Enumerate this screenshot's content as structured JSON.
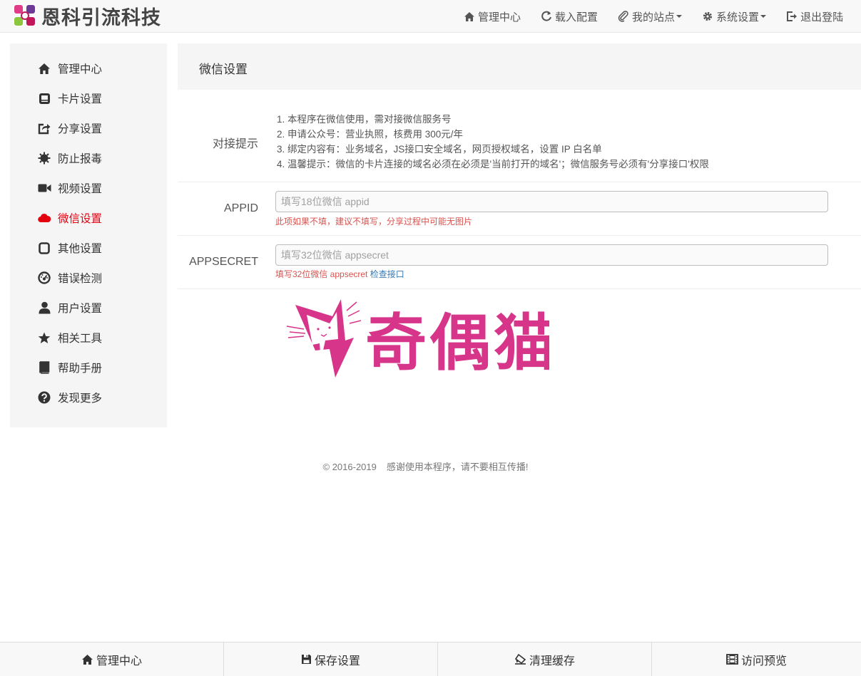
{
  "brand": {
    "name": "恩科引流科技"
  },
  "nav": {
    "items": [
      {
        "label": "管理中心",
        "icon": "home-icon"
      },
      {
        "label": "载入配置",
        "icon": "refresh-icon"
      },
      {
        "label": "我的站点",
        "icon": "paperclip-icon",
        "dropdown": true
      },
      {
        "label": "系统设置",
        "icon": "gear-icon",
        "dropdown": true
      },
      {
        "label": "退出登陆",
        "icon": "logout-icon"
      }
    ]
  },
  "sidebar": {
    "items": [
      {
        "label": "管理中心",
        "icon": "home-icon"
      },
      {
        "label": "卡片设置",
        "icon": "card-icon"
      },
      {
        "label": "分享设置",
        "icon": "share-icon"
      },
      {
        "label": "防止报毒",
        "icon": "virus-icon"
      },
      {
        "label": "视频设置",
        "icon": "video-icon"
      },
      {
        "label": "微信设置",
        "icon": "cloud-icon",
        "active": true
      },
      {
        "label": "其他设置",
        "icon": "square-icon"
      },
      {
        "label": "错误检测",
        "icon": "dashboard-icon"
      },
      {
        "label": "用户设置",
        "icon": "user-icon"
      },
      {
        "label": "相关工具",
        "icon": "star-icon"
      },
      {
        "label": "帮助手册",
        "icon": "book-icon"
      },
      {
        "label": "发现更多",
        "icon": "question-icon"
      }
    ]
  },
  "panel": {
    "title": "微信设置"
  },
  "tips": {
    "label": "对接提示",
    "lines": [
      "1. 本程序在微信使用，需对接微信服务号",
      "2. 申请公众号：营业执照，核费用 300元/年",
      "3. 绑定内容有：业务域名，JS接口安全域名，网页授权域名，设置 IP 白名单",
      "4. 温馨提示：微信的卡片连接的域名必须在必须是'当前打开的域名'；微信服务号必须有'分享接口'权限"
    ]
  },
  "appid": {
    "label": "APPID",
    "value": "",
    "placeholder": "填写18位微信 appid",
    "help": "此项如果不填，建议不填写，分享过程中可能无图片"
  },
  "appsecret": {
    "label": "APPSECRET",
    "value": "",
    "placeholder": "填写32位微信 appsecret",
    "help": "填写32位微信 appsecret",
    "link": "检查接口"
  },
  "watermark": {
    "text": "奇偶猫",
    "color": "#d6358a"
  },
  "footer": {
    "copyright": "© 2016-2019",
    "note": "感谢使用本程序，请不要相互传播!"
  },
  "bottombar": {
    "items": [
      {
        "label": "管理中心",
        "icon": "home-icon"
      },
      {
        "label": "保存设置",
        "icon": "save-icon"
      },
      {
        "label": "清理缓存",
        "icon": "eraser-icon"
      },
      {
        "label": "访问预览",
        "icon": "film-icon"
      }
    ]
  },
  "colors": {
    "accent": "#e4000f",
    "help": "#d9534f",
    "link": "#337ab7"
  }
}
